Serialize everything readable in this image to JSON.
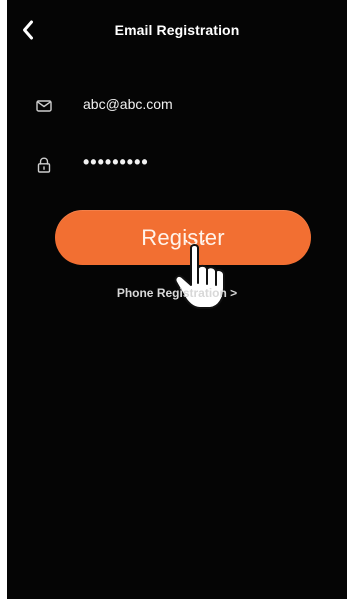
{
  "header": {
    "title": "Email Registration",
    "back_icon": "chevron-left-icon"
  },
  "form": {
    "email": {
      "icon": "mail-icon",
      "value": "abc@abc.com"
    },
    "password": {
      "icon": "lock-icon",
      "value": "•••••••••"
    },
    "register_label": "Register",
    "phone_link": "Phone Registration >"
  },
  "colors": {
    "background": "#050505",
    "accent": "#f26f32",
    "text": "#ffffff",
    "muted_text": "#d8d8d8"
  }
}
